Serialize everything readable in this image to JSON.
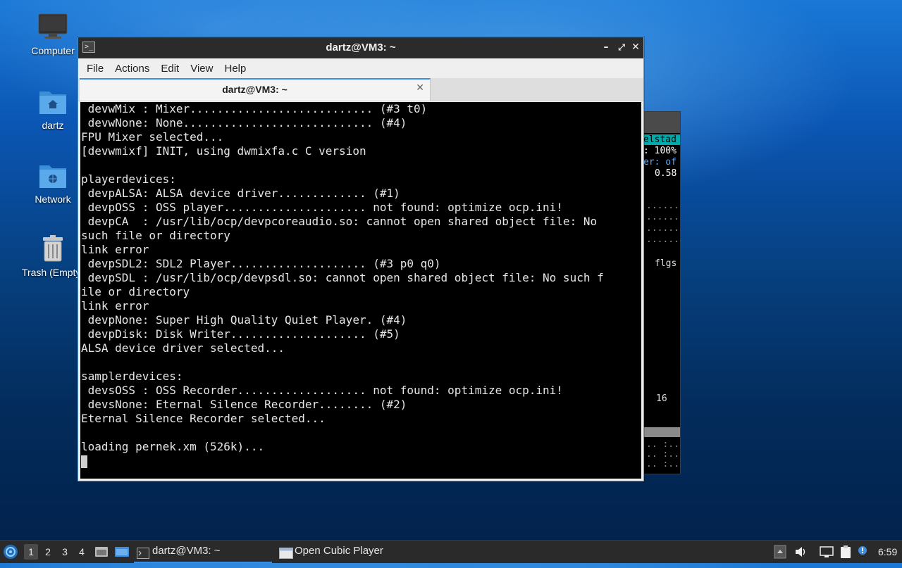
{
  "desktop": {
    "icons": [
      {
        "label": "Computer",
        "icon": "monitor-icon"
      },
      {
        "label": "dartz",
        "icon": "home-folder-icon"
      },
      {
        "label": "Network",
        "icon": "network-folder-icon"
      },
      {
        "label": "Trash (Empty)",
        "icon": "trash-icon"
      }
    ]
  },
  "ocp_window": {
    "fragments": [
      "elstad",
      ": 100%",
      "er: of",
      "0.58",
      "flgs",
      "16"
    ]
  },
  "terminal": {
    "window_title": "dartz@VM3: ~",
    "menu": [
      "File",
      "Actions",
      "Edit",
      "View",
      "Help"
    ],
    "tab_title": "dartz@VM3: ~",
    "lines": [
      " devwMix : Mixer........................... (#3 t0)",
      " devwNone: None............................ (#4)",
      "FPU Mixer selected...",
      "[devwmixf] INIT, using dwmixfa.c C version",
      "",
      "playerdevices:",
      " devpALSA: ALSA device driver............. (#1)",
      " devpOSS : OSS player..................... not found: optimize ocp.ini!",
      " devpCA  : /usr/lib/ocp/devpcoreaudio.so: cannot open shared object file: No",
      "such file or directory",
      "link error",
      " devpSDL2: SDL2 Player.................... (#3 p0 q0)",
      " devpSDL : /usr/lib/ocp/devpsdl.so: cannot open shared object file: No such f",
      "ile or directory",
      "link error",
      " devpNone: Super High Quality Quiet Player. (#4)",
      " devpDisk: Disk Writer.................... (#5)",
      "ALSA device driver selected...",
      "",
      "samplerdevices:",
      " devsOSS : OSS Recorder................... not found: optimize ocp.ini!",
      " devsNone: Eternal Silence Recorder........ (#2)",
      "Eternal Silence Recorder selected...",
      "",
      "loading pernek.xm (526k)..."
    ]
  },
  "taskbar": {
    "workspaces": [
      "1",
      "2",
      "3",
      "4"
    ],
    "active_workspace": "1",
    "tasks": [
      {
        "label": "dartz@VM3: ~",
        "icon": "terminal-icon",
        "active": true
      },
      {
        "label": "Open Cubic Player",
        "icon": "window-icon",
        "active": false
      }
    ],
    "clock": "6:59"
  },
  "colors": {
    "accent": "#3d8ee0",
    "terminal_bg": "#000000",
    "terminal_fg": "#e6e6e6",
    "taskbar_bg": "#2a2a2a",
    "ocp_cyan": "#00aaaa"
  }
}
